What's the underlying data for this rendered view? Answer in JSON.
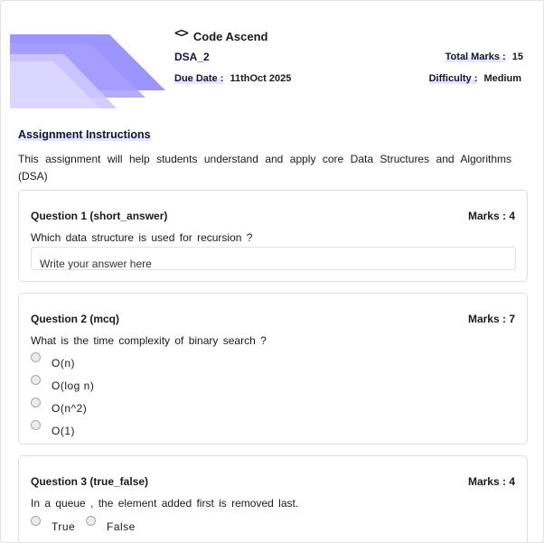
{
  "header": {
    "brand_name": "Code Ascend",
    "brand_icon": "code-brackets-icon",
    "assignment_name": "DSA_2",
    "due_date_label": "Due Date :",
    "due_date_value": "11thOct 2025",
    "total_marks_label": "Total Marks :",
    "total_marks_value": "15",
    "difficulty_label": "Difficulty :",
    "difficulty_value": "Medium"
  },
  "instructions": {
    "title": "Assignment Instructions",
    "text": "This assignment will help students understand and apply core Data Structures and Algorithms (DSA)"
  },
  "questions": [
    {
      "heading": "Question 1 (short_answer)",
      "marks": "Marks : 4",
      "text": "Which data structure is used for recursion ?",
      "answer_placeholder": "Write your answer here"
    },
    {
      "heading": "Question 2 (mcq)",
      "marks": "Marks : 7",
      "text": "What is the time complexity of binary search ?",
      "options": [
        "O(n)",
        "O(log n)",
        "O(n^2)",
        "O(1)"
      ]
    },
    {
      "heading": "Question 3 (true_false)",
      "marks": "Marks : 4",
      "text": "In a queue , the element added first is removed last.",
      "options": [
        "True",
        "False"
      ]
    }
  ],
  "colors": {
    "banner_purple": "#8c82ff",
    "banner_light": "#d2ceff",
    "heading_navy": "#14143a"
  }
}
